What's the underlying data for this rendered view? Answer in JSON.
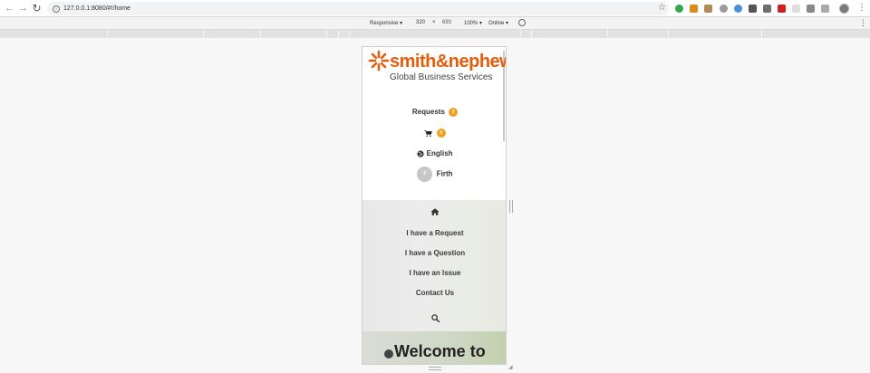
{
  "browser": {
    "url": "127.0.0.1:8080/#!/home",
    "url_host": "127.0.0.1",
    "url_path": ":8080/#!/home"
  },
  "device_toolbar": {
    "device": "Responsive ▾",
    "width": "320",
    "times": "×",
    "height": "693",
    "zoom": "100% ▾",
    "network": "Online ▾"
  },
  "logo": {
    "name": "smith&nephew",
    "tagline": "Global Business Services",
    "color": "#e35d0c"
  },
  "header_menu": {
    "requests_label": "Requests",
    "requests_count": "0",
    "cart_count": "0",
    "language": "English",
    "user_initial": "F",
    "user_name": "Firth"
  },
  "nav": {
    "home_icon": "home-icon",
    "items": [
      {
        "label": "I have a Request"
      },
      {
        "label": "I have a Question"
      },
      {
        "label": "I have an Issue"
      },
      {
        "label": "Contact Us"
      }
    ],
    "search_icon": "search-icon"
  },
  "hero": {
    "title": "Welcome to"
  },
  "colors": {
    "accent": "#e35d0c",
    "badge": "#f0a020"
  }
}
